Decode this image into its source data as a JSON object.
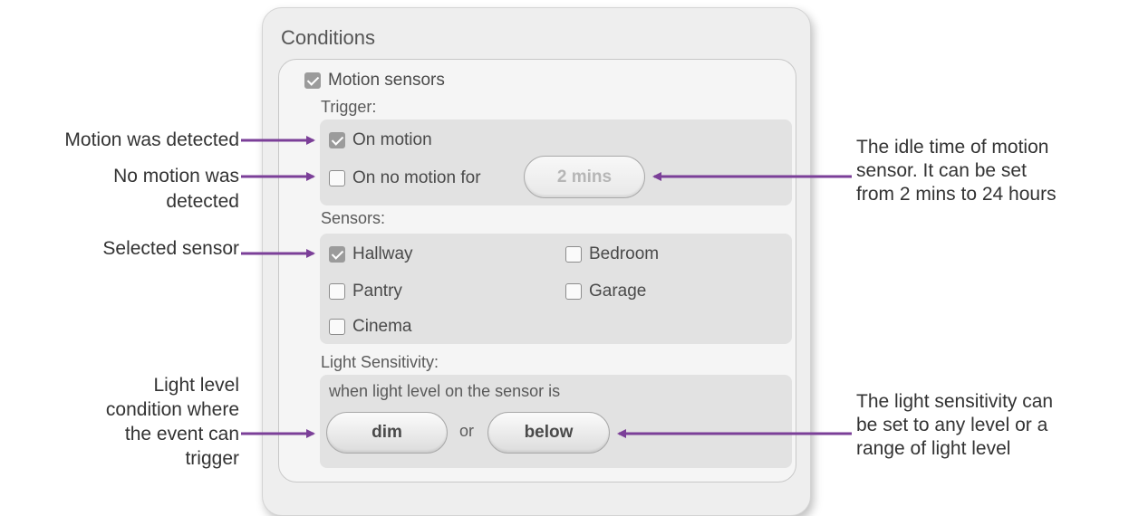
{
  "panel": {
    "title": "Conditions",
    "motion_sensors": {
      "label": "Motion sensors",
      "checked": true
    },
    "trigger": {
      "label": "Trigger:",
      "on_motion": {
        "label": "On motion",
        "checked": true
      },
      "on_no_motion": {
        "label": "On no motion for",
        "checked": false,
        "duration": "2 mins"
      }
    },
    "sensors": {
      "label": "Sensors:",
      "items": [
        {
          "label": "Hallway",
          "checked": true
        },
        {
          "label": "Bedroom",
          "checked": false
        },
        {
          "label": "Pantry",
          "checked": false
        },
        {
          "label": "Garage",
          "checked": false
        },
        {
          "label": "Cinema",
          "checked": false
        }
      ]
    },
    "light": {
      "label": "Light Sensitivity:",
      "description": "when light level on the sensor is",
      "level": "dim",
      "connector": "or",
      "comparison": "below"
    }
  },
  "annotations": {
    "motion_detected": "Motion was detected",
    "no_motion_1": "No motion was",
    "no_motion_2": "detected",
    "selected_sensor": "Selected sensor",
    "light_level_1": "Light level",
    "light_level_2": "condition where",
    "light_level_3": "the event can",
    "light_level_4": "trigger",
    "idle_time_1": "The idle time of motion",
    "idle_time_2": "sensor. It can be set",
    "idle_time_3": "from 2 mins to 24 hours",
    "light_sens_1": "The light sensitivity can",
    "light_sens_2": "be set to any level or a",
    "light_sens_3": "range of light level"
  },
  "colors": {
    "arrow": "#7b3f98",
    "panel": "#eeeeee",
    "group": "#e2e2e2"
  }
}
